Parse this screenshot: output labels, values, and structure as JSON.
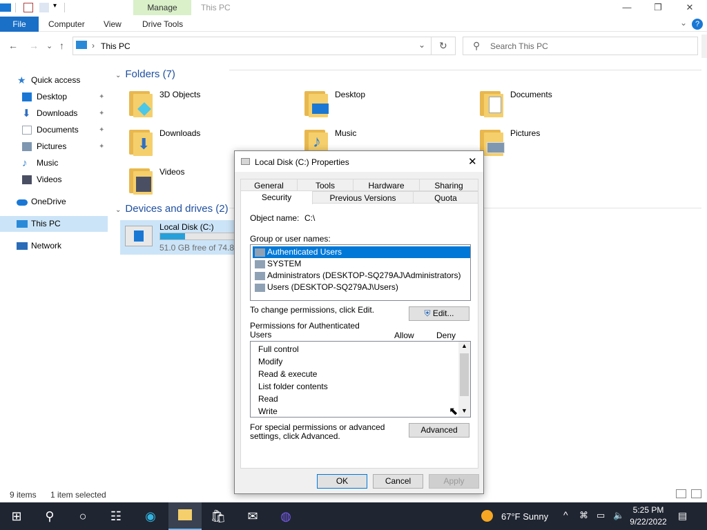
{
  "window": {
    "manage_label": "Manage",
    "title": "This PC",
    "minimize": "—",
    "maximize": "❐",
    "close": "✕"
  },
  "ribbon": {
    "file": "File",
    "tabs": [
      "Computer",
      "View",
      "Drive Tools"
    ],
    "expand": "⌄",
    "help": "?"
  },
  "address": {
    "back": "←",
    "forward": "→",
    "recent": "⌄",
    "up": "↑",
    "path_sep": "›",
    "path": "This PC",
    "dropdown": "⌄",
    "refresh": "↻",
    "search_icon": "⚲",
    "search_placeholder": "Search This PC"
  },
  "sidebar": {
    "items": [
      {
        "label": "Quick access",
        "icon": "star-icon",
        "color": "#2f7fd1"
      },
      {
        "label": "Desktop",
        "icon": "desktop-icon",
        "color": "#1a78d4",
        "pinned": true
      },
      {
        "label": "Downloads",
        "icon": "download-icon",
        "color": "#2f6fc4",
        "pinned": true
      },
      {
        "label": "Documents",
        "icon": "documents-icon",
        "color": "#9aa5b1",
        "pinned": true
      },
      {
        "label": "Pictures",
        "icon": "pictures-icon",
        "color": "#7f97b0",
        "pinned": true
      },
      {
        "label": "Music",
        "icon": "music-icon",
        "color": "#2f7fd1"
      },
      {
        "label": "Videos",
        "icon": "videos-icon",
        "color": "#4a4f63"
      },
      {
        "label": "OneDrive",
        "icon": "onedrive-icon",
        "color": "#1a78d4"
      },
      {
        "label": "This PC",
        "icon": "this-pc-icon",
        "color": "#2b8ad8",
        "selected": true
      },
      {
        "label": "Network",
        "icon": "network-icon",
        "color": "#2b6cb8"
      }
    ],
    "pin_glyph": "📌"
  },
  "content": {
    "folders_header": "Folders (7)",
    "folders": [
      {
        "label": "3D Objects",
        "icon": "3d-objects-icon"
      },
      {
        "label": "Desktop",
        "icon": "desktop-folder-icon"
      },
      {
        "label": "Documents",
        "icon": "documents-folder-icon"
      },
      {
        "label": "Downloads",
        "icon": "downloads-folder-icon"
      },
      {
        "label": "Music",
        "icon": "music-folder-icon"
      },
      {
        "label": "Pictures",
        "icon": "pictures-folder-icon"
      },
      {
        "label": "Videos",
        "icon": "videos-folder-icon"
      }
    ],
    "devices_header": "Devices and drives (2)",
    "drive": {
      "label": "Local Disk (C:)",
      "free": "51.0 GB free of 74.8 G",
      "used_fraction": 0.32
    }
  },
  "status": {
    "items": "9 items",
    "selected": "1 item selected"
  },
  "dialog": {
    "title": "Local Disk (C:) Properties",
    "close": "✕",
    "tabs_row1": [
      "General",
      "Tools",
      "Hardware",
      "Sharing"
    ],
    "tabs_row2": [
      "Security",
      "Previous Versions",
      "Quota"
    ],
    "object_name_label": "Object name:",
    "object_name_value": "C:\\",
    "group_label": "Group or user names:",
    "users": [
      "Authenticated Users",
      "SYSTEM",
      "Administrators (DESKTOP-SQ279AJ\\Administrators)",
      "Users (DESKTOP-SQ279AJ\\Users)"
    ],
    "change_perm_text": "To change permissions, click Edit.",
    "edit_button": "Edit...",
    "perm_label": "Permissions for Authenticated Users",
    "allow": "Allow",
    "deny": "Deny",
    "permissions": [
      "Full control",
      "Modify",
      "Read & execute",
      "List folder contents",
      "Read",
      "Write"
    ],
    "special_text": "For special permissions or advanced settings, click Advanced.",
    "advanced_button": "Advanced",
    "ok": "OK",
    "cancel": "Cancel",
    "apply": "Apply"
  },
  "taskbar": {
    "weather": "67°F  Sunny",
    "time": "5:25 PM",
    "date": "9/22/2022",
    "accent": "#1f2531"
  }
}
